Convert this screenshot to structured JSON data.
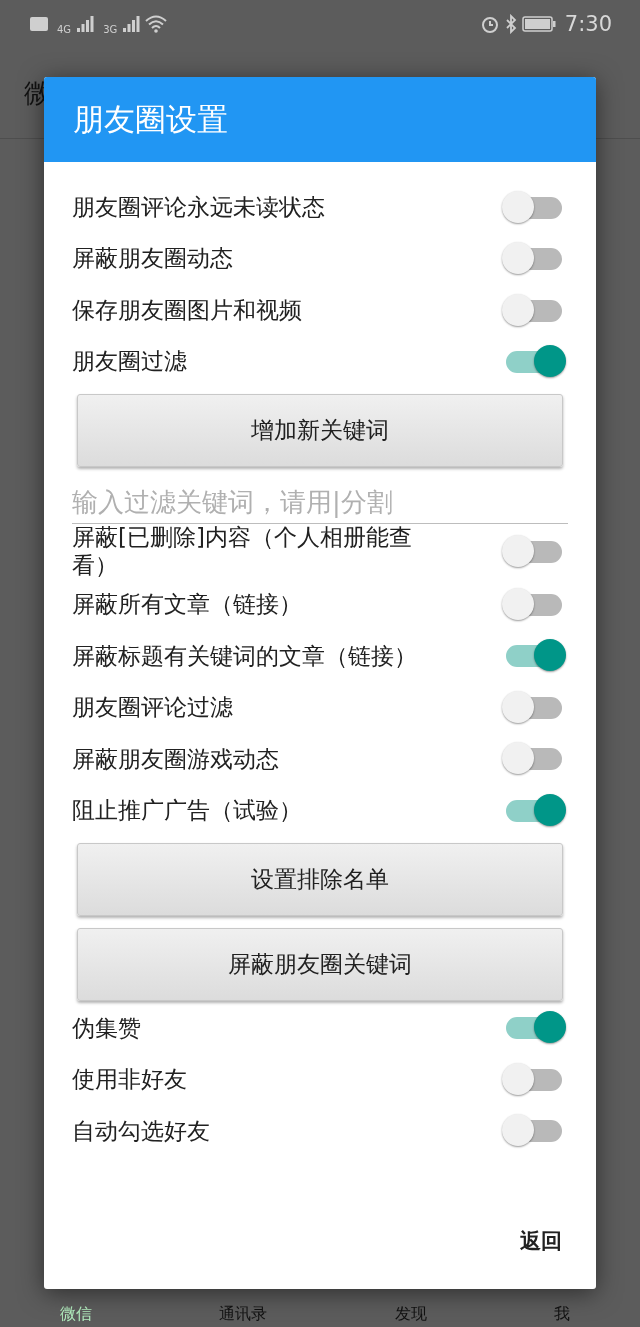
{
  "status_bar": {
    "time": "7:30",
    "network_1": "4G",
    "network_2": "3G"
  },
  "app": {
    "title": "微",
    "tabs": [
      {
        "label": "微信",
        "selected": true
      },
      {
        "label": "通讯录",
        "selected": false
      },
      {
        "label": "发现",
        "selected": false
      },
      {
        "label": "我",
        "selected": false
      }
    ]
  },
  "dialog": {
    "title": "朋友圈设置",
    "items": [
      {
        "kind": "toggle",
        "label": "朋友圈评论永远未读状态",
        "on": false
      },
      {
        "kind": "toggle",
        "label": "屏蔽朋友圈动态",
        "on": false
      },
      {
        "kind": "toggle",
        "label": "保存朋友圈图片和视频",
        "on": false
      },
      {
        "kind": "toggle",
        "label": "朋友圈过滤",
        "on": true
      },
      {
        "kind": "button",
        "label": "增加新关键词"
      },
      {
        "kind": "input",
        "placeholder": "输入过滤关键词，请用|分割"
      },
      {
        "kind": "toggle",
        "label": "屏蔽[已删除]内容（个人相册能查看）",
        "on": false
      },
      {
        "kind": "toggle",
        "label": "屏蔽所有文章（链接）",
        "on": false
      },
      {
        "kind": "toggle",
        "label": "屏蔽标题有关键词的文章（链接）",
        "on": true
      },
      {
        "kind": "toggle",
        "label": "朋友圈评论过滤",
        "on": false
      },
      {
        "kind": "toggle",
        "label": "屏蔽朋友圈游戏动态",
        "on": false
      },
      {
        "kind": "toggle",
        "label": "阻止推广广告（试验）",
        "on": true
      },
      {
        "kind": "button",
        "label": "设置排除名单"
      },
      {
        "kind": "button",
        "label": "屏蔽朋友圈关键词"
      },
      {
        "kind": "toggle",
        "label": "伪集赞",
        "on": true
      },
      {
        "kind": "toggle",
        "label": "使用非好友",
        "on": false
      },
      {
        "kind": "toggle",
        "label": "自动勾选好友",
        "on": false
      }
    ],
    "back_button": "返回"
  }
}
